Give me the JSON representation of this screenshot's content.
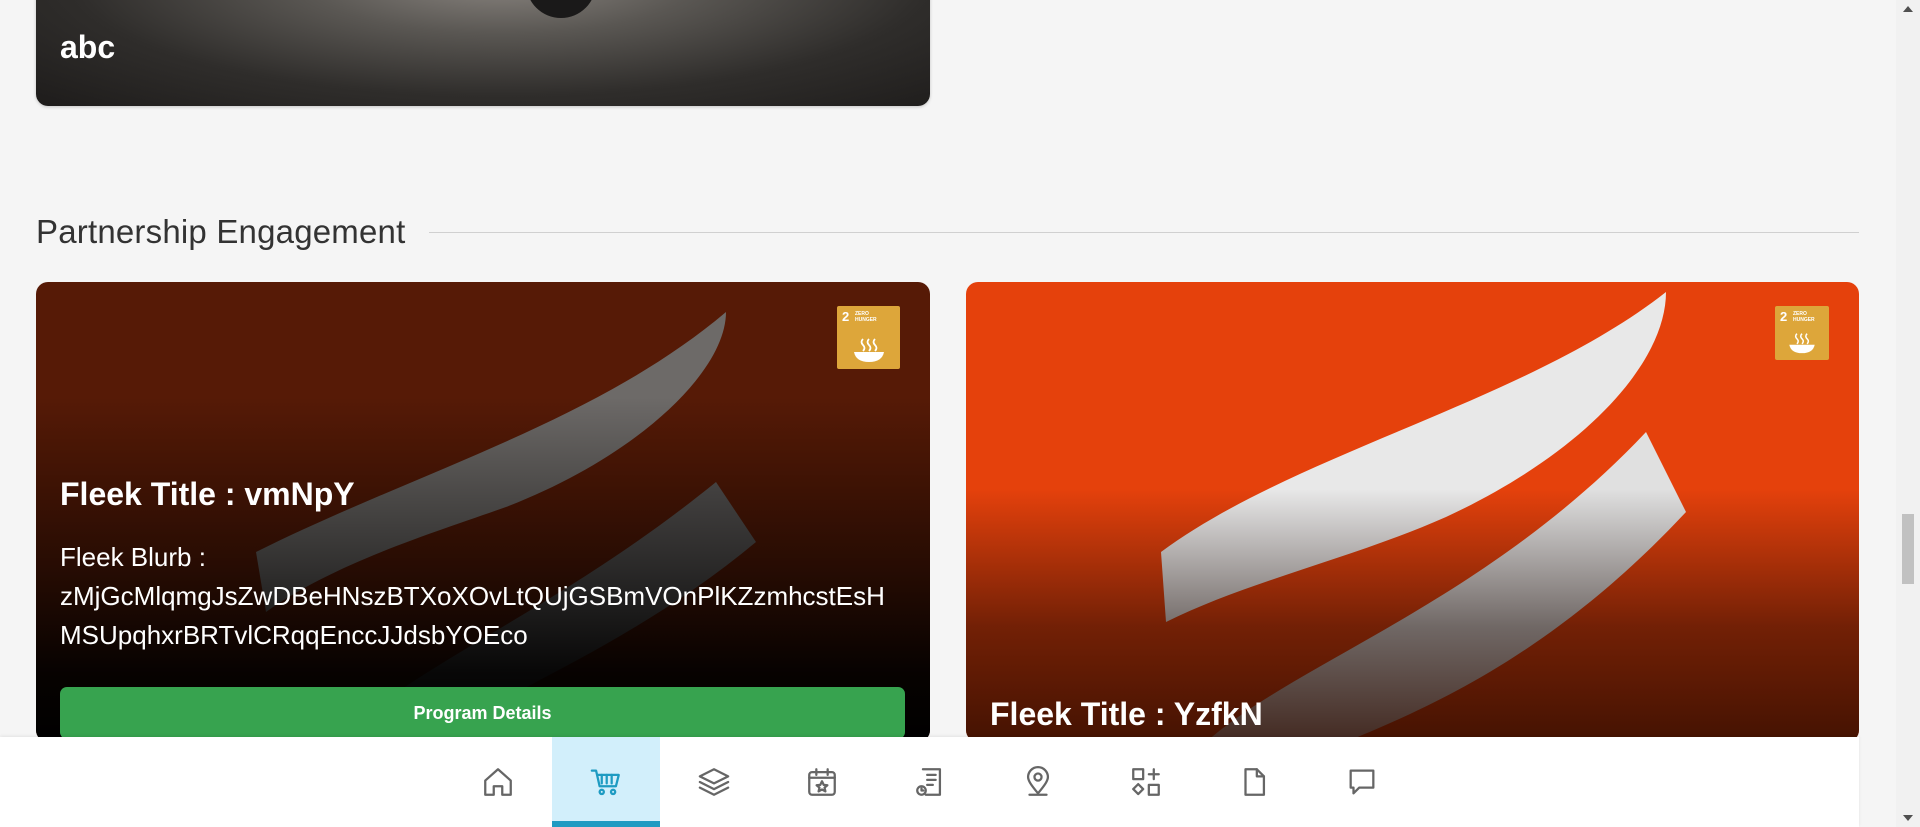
{
  "previous_card": {
    "title": "abc"
  },
  "section": {
    "title": "Partnership Engagement"
  },
  "cards": [
    {
      "sdg_number": "2",
      "sdg_label": "ZERO HUNGER",
      "title": "Fleek Title : vmNpY",
      "blurb_label": "Fleek Blurb :",
      "blurb_text": "zMjGcMlqmgJsZwDBeHNszBTXoXOvLtQUjGSBmVOnPlKZzmhcstEsHMSUpqhxrBRTvlCRqqEnccJJdsbYOEco",
      "button_label": "Program Details"
    },
    {
      "sdg_number": "2",
      "sdg_label": "ZERO HUNGER",
      "title": "Fleek Title : YzfkN"
    }
  ],
  "bottom_nav": {
    "active": "cart",
    "items": [
      "home-icon",
      "cart-icon",
      "layers-icon",
      "calendar-star-icon",
      "document-list-icon",
      "location-pin-icon",
      "apps-icon",
      "file-icon",
      "chat-icon"
    ]
  },
  "colors": {
    "accent": "#1e9bc2",
    "button_green": "#37a34f",
    "sdg_gold": "#dda63a"
  }
}
